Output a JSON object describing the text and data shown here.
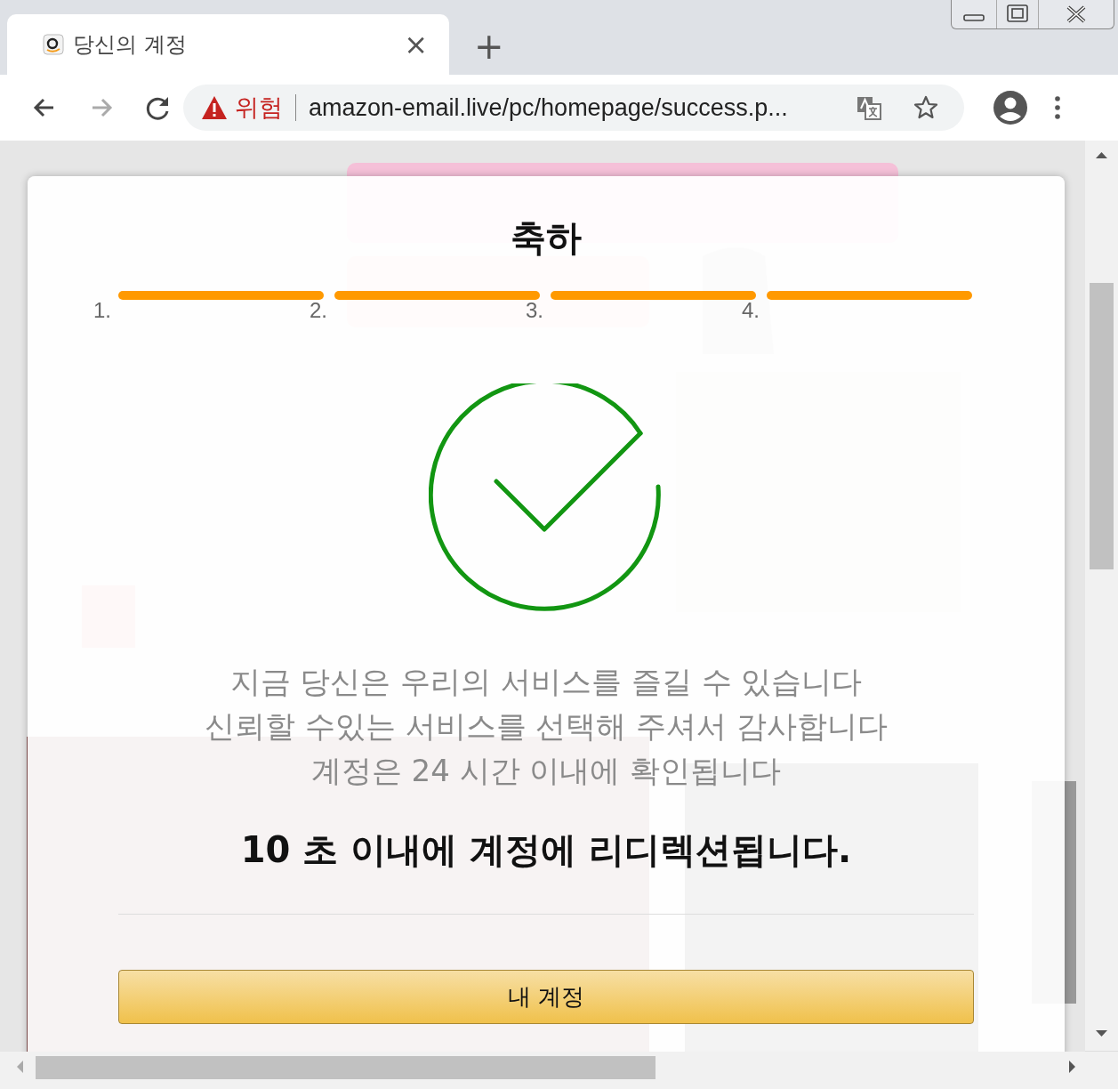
{
  "browser": {
    "tab": {
      "title": "당신의 계정",
      "close": "×"
    },
    "new_tab": "+",
    "address_bar": {
      "security_label": "위험",
      "url": "amazon-email.live/pc/homepage/success.p..."
    }
  },
  "dialog": {
    "title": "축하",
    "progress": {
      "segments": [
        {
          "completed": true
        },
        {
          "completed": true
        },
        {
          "completed": true
        },
        {
          "completed": true
        }
      ],
      "step_labels": [
        "1.",
        "2.",
        "3.",
        "4."
      ]
    },
    "messages": [
      "지금 당신은 우리의 서비스를 즐길 수 있습니다",
      "신뢰할 수있는 서비스를 선택해 주셔서 감사합니다",
      "계정은 24 시간 이내에 확인됩니다"
    ],
    "redirect_notice": "10 초 이내에 계정에 리디렉션됩니다.",
    "button": "내 계정"
  }
}
